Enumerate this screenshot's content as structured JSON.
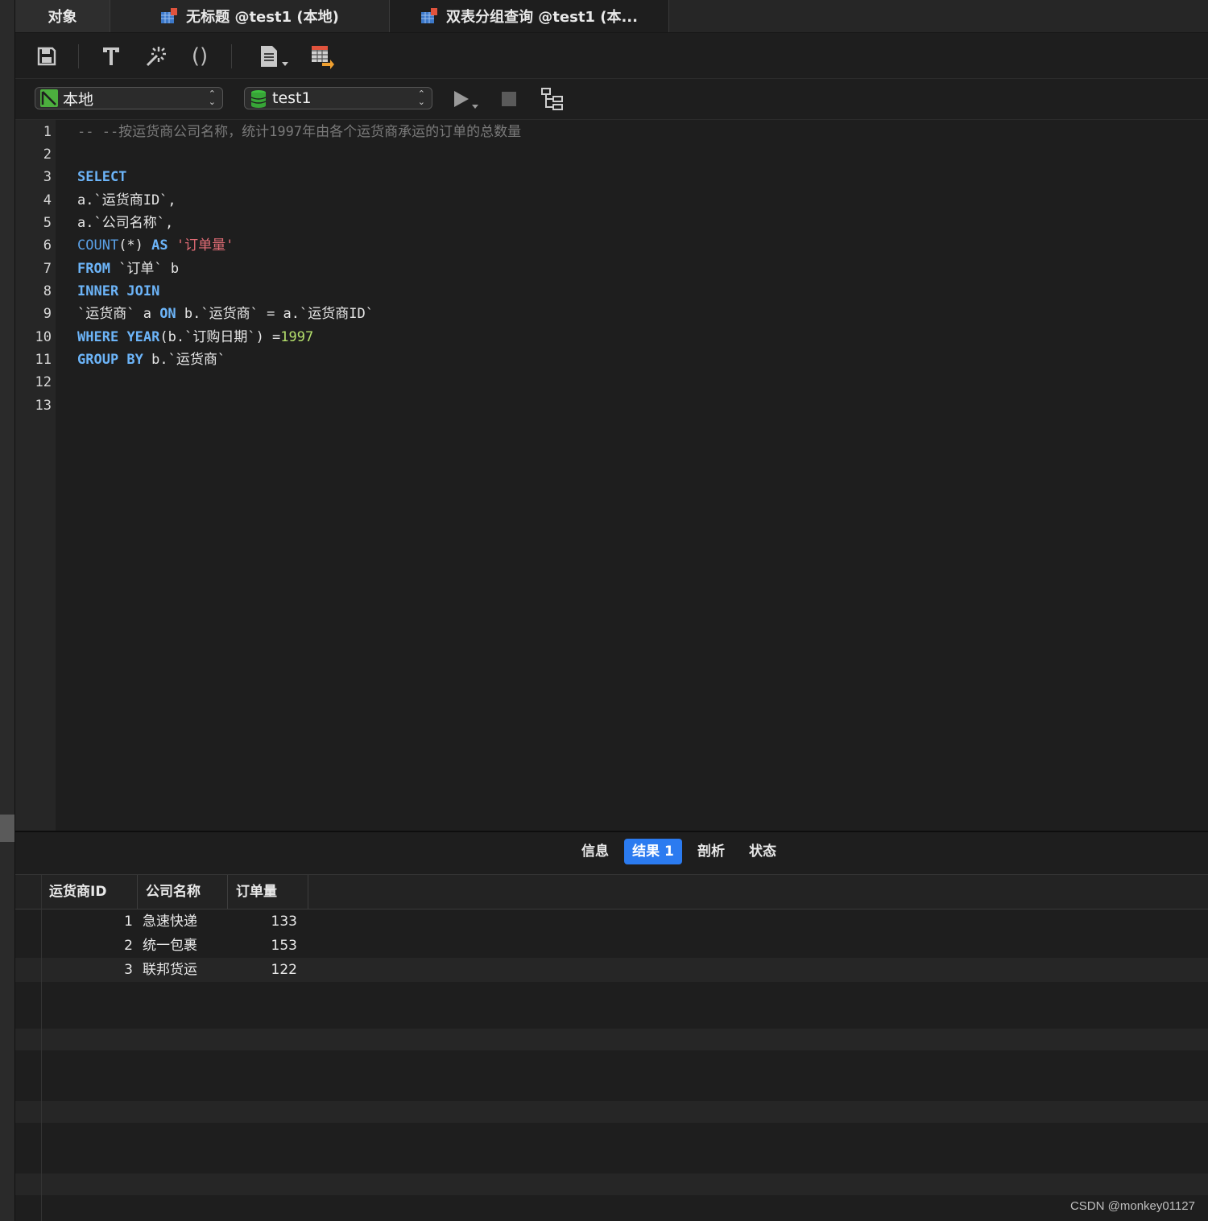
{
  "tabs": [
    {
      "label": "对象"
    },
    {
      "label": "无标题 @test1 (本地)",
      "icon": "query-table-icon"
    },
    {
      "label": "双表分组查询 @test1 (本...",
      "icon": "query-table-icon"
    }
  ],
  "toolbar": {
    "save": "save-icon",
    "format": "text-format-icon",
    "beautify": "magic-wand-icon",
    "parentheses": "()",
    "snippet": "document-icon",
    "export": "export-results-icon"
  },
  "connection": {
    "server": "本地",
    "database": "test1",
    "run_label": "▶",
    "stop_label": "■"
  },
  "editor": {
    "line_numbers": [
      "1",
      "2",
      "3",
      "4",
      "5",
      "6",
      "7",
      "8",
      "9",
      "10",
      "11",
      "12",
      "13"
    ],
    "comment": "-- --按运货商公司名称，统计1997年由各个运货商承运的订单的总数量",
    "l3": "SELECT",
    "l4": "a.`运货商ID`,",
    "l5": "a.`公司名称`,",
    "l6_fn": "COUNT",
    "l6_args": "(*) ",
    "l6_as": "AS",
    "l6_str": "'订单量'",
    "l7_kw": "FROM",
    "l7_rest": " `订单` b",
    "l8": "INNER JOIN",
    "l9_pre": "`运货商` a ",
    "l9_on": "ON",
    "l9_rest": " b.`运货商` = a.`运货商ID`",
    "l10_where": "WHERE",
    "l10_year": "YEAR",
    "l10_mid": "(b.`订购日期`) =",
    "l10_num": "1997",
    "l11_kw": "GROUP BY",
    "l11_rest": " b.`运货商`"
  },
  "result_tabs": {
    "info": "信息",
    "result1": "结果 1",
    "profile": "剖析",
    "status": "状态"
  },
  "table": {
    "headers": [
      "运货商ID",
      "公司名称",
      "订单量"
    ],
    "rows": [
      [
        "1",
        "急速快递",
        "133"
      ],
      [
        "2",
        "统一包裹",
        "153"
      ],
      [
        "3",
        "联邦货运",
        "122"
      ]
    ]
  },
  "watermark": "CSDN @monkey01127"
}
